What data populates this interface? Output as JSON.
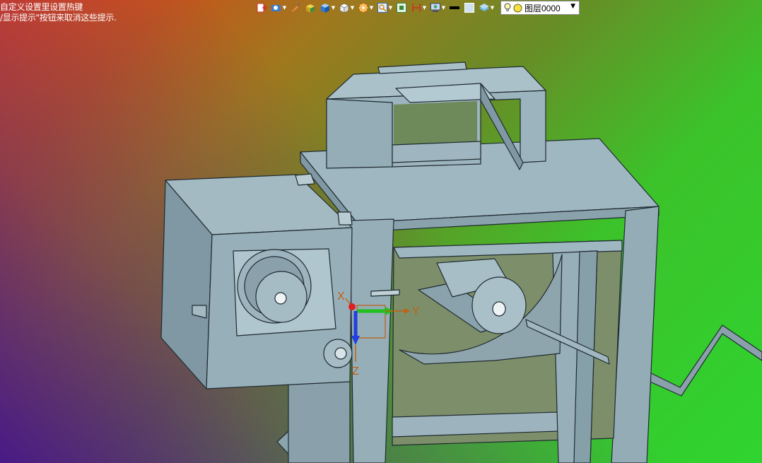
{
  "hint": {
    "line1": "自定义设置里设置热键",
    "line2": "/显示提示\"按钮来取消这些提示."
  },
  "toolbar": {
    "icons": [
      {
        "name": "exit-icon",
        "dropdown": false
      },
      {
        "name": "view-tools-icon",
        "dropdown": true
      },
      {
        "name": "brush-icon",
        "dropdown": false
      },
      {
        "name": "solid-shade-icon",
        "dropdown": false
      },
      {
        "name": "cube-blue-icon",
        "dropdown": true
      },
      {
        "name": "cube-white-icon",
        "dropdown": true
      },
      {
        "name": "color-wheel-icon",
        "dropdown": true
      },
      {
        "name": "zoom-window-icon",
        "dropdown": true
      },
      {
        "name": "fit-view-icon",
        "dropdown": false
      },
      {
        "name": "section-icon",
        "dropdown": true
      },
      {
        "name": "layer-manager-icon",
        "dropdown": true
      },
      {
        "name": "line-color-icon",
        "dropdown": false
      },
      {
        "name": "fill-color-icon",
        "dropdown": false
      },
      {
        "name": "layer-stack-icon",
        "dropdown": true
      }
    ],
    "layer": {
      "value": "图层0000"
    }
  },
  "triad": {
    "x_label": "X",
    "y_label": "Y",
    "z_label": "Z"
  },
  "colors": {
    "model_fill": "#8fa8b2",
    "model_edge": "#1f2a30",
    "accent_x": "#e02020",
    "accent_y": "#20c020",
    "accent_z": "#2040e0"
  }
}
